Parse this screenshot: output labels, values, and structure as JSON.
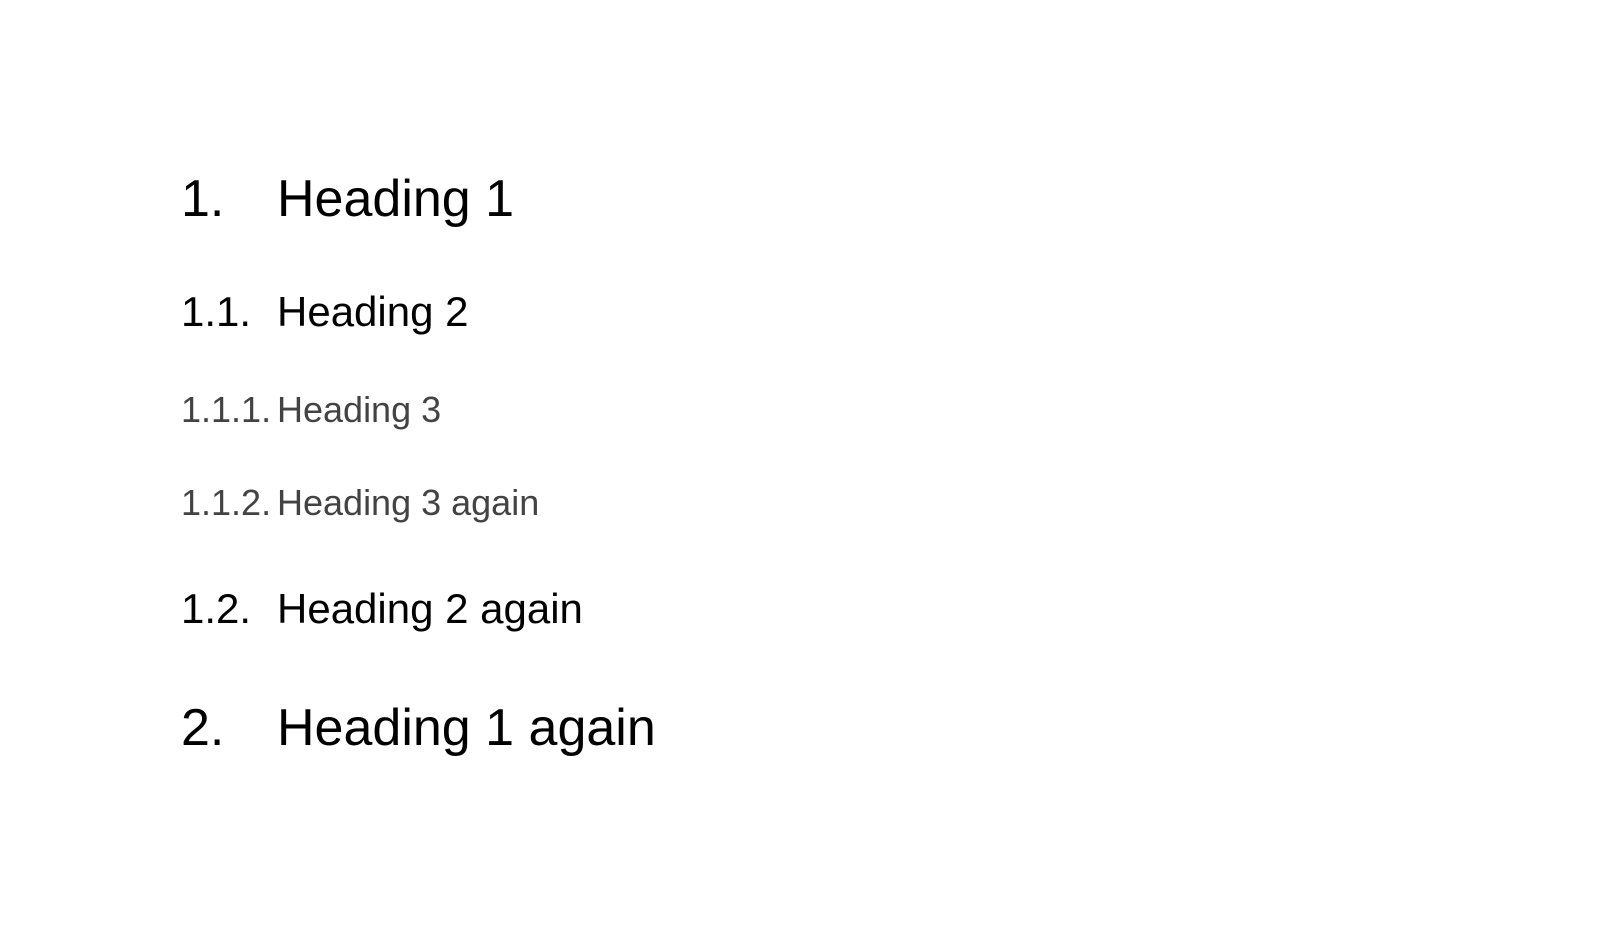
{
  "document": {
    "headings": [
      {
        "level": 1,
        "number": "1.",
        "text": "Heading 1"
      },
      {
        "level": 2,
        "number": "1.1.",
        "text": "Heading 2"
      },
      {
        "level": 3,
        "number": "1.1.1.",
        "text": "Heading 3"
      },
      {
        "level": 3,
        "number": "1.1.2.",
        "text": "Heading 3 again"
      },
      {
        "level": 2,
        "number": "1.2.",
        "text": "Heading 2 again"
      },
      {
        "level": 1,
        "number": "2.",
        "text": "Heading 1 again"
      }
    ]
  },
  "colors": {
    "background": "#ffffff",
    "heading_primary": "#000000",
    "heading_level3": "#434343"
  }
}
